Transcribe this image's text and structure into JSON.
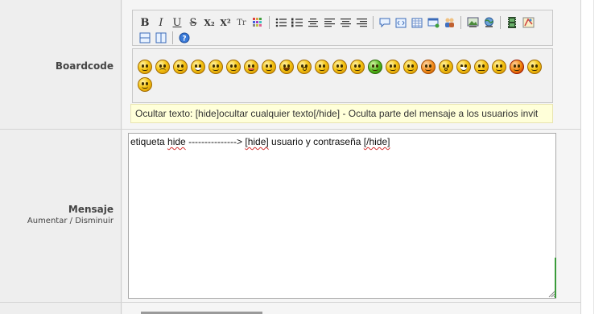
{
  "rows": {
    "boardcode_label": "Boardcode",
    "mensaje_label": "Mensaje",
    "aumentar_label": "Aumentar",
    "separator": "/",
    "disminuir_label": "Disminuir"
  },
  "toolbar": {
    "row1": [
      "bold-icon",
      "italic-icon",
      "underline-icon",
      "strikethrough-icon",
      "subscript-icon",
      "superscript-icon",
      "typewriter-text-icon",
      "color-grid-icon",
      "|",
      "bulleted-list-icon",
      "numbered-list-icon",
      "align-left-icon",
      "align-center-icon",
      "align-right-icon",
      "align-justify-icon",
      "|",
      "quote-icon",
      "code-icon",
      "table-icon",
      "spoiler-icon",
      "users-icon",
      "|",
      "image-icon",
      "link-globe-icon",
      "|",
      "video-icon",
      "flash-icon"
    ],
    "row2": [
      "split-horizontal-icon",
      "split-vertical-icon",
      "|",
      "help-icon"
    ],
    "bold": "B",
    "italic": "I",
    "underline": "U",
    "strike": "S",
    "sub": "X₂",
    "sup": "X²",
    "tt": "Tr"
  },
  "smileys": [
    "cool",
    "sad",
    "smile",
    "grin",
    "happy",
    "wink",
    "tongue",
    "squint",
    "laugh",
    "surprised",
    "confused",
    "blink",
    "sick",
    "tired",
    "rolleyes",
    "shocked",
    "oh",
    "bigeyes",
    "neutral",
    "dizzy",
    "devil",
    "hmm",
    "x-eyes"
  ],
  "hint_text": "Ocultar texto: [hide]ocultar cualquier texto[/hide] - Oculta parte del mensaje a los usuarios invit",
  "message": {
    "p1": "etiqueta ",
    "w1": "hide",
    "p2": " ---------------> ",
    "w2": "[hide]",
    "p3": " usuario y contraseña ",
    "w3": "[/hide]"
  }
}
